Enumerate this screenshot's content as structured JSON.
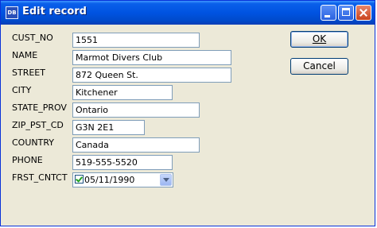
{
  "window": {
    "title": "Edit record",
    "icon_name": "app-icon",
    "controls": [
      "minimize-icon",
      "maximize-icon",
      "close-icon"
    ]
  },
  "form": {
    "fields": [
      {
        "label": "CUST_NO",
        "value": "1551"
      },
      {
        "label": "NAME",
        "value": "Marmot Divers Club"
      },
      {
        "label": "STREET",
        "value": "872 Queen St."
      },
      {
        "label": "CITY",
        "value": "Kitchener"
      },
      {
        "label": "STATE_PROV",
        "value": "Ontario"
      },
      {
        "label": "ZIP_PST_CD",
        "value": "G3N 2E1"
      },
      {
        "label": "COUNTRY",
        "value": "Canada"
      },
      {
        "label": "PHONE",
        "value": "519-555-5520"
      },
      {
        "label": "FRST_CNTCT",
        "value": "05/11/1990",
        "checked": true
      }
    ]
  },
  "buttons": {
    "ok_label": "OK",
    "cancel_label": "Cancel"
  },
  "colors": {
    "titlebar": "#0053e1",
    "dialog_bg": "#ece9d8",
    "field_border": "#7f9db9"
  }
}
